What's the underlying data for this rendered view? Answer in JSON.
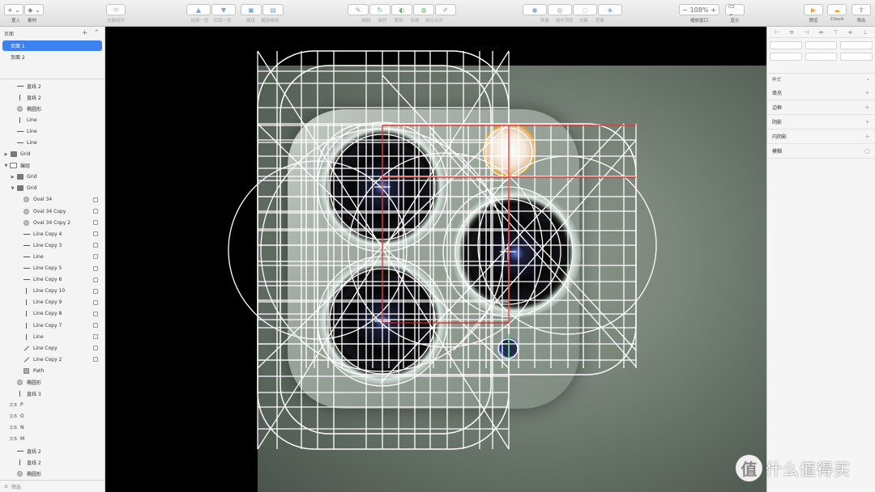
{
  "toolbar": {
    "insert_label": "置入",
    "material_label": "素材",
    "create_symbol_label": "创建组件",
    "front_back_labels": [
      "前面一层",
      "后面一层"
    ],
    "group_label": "编组",
    "ungroup_label": "解除编组",
    "path_tools_labels": [
      "编辑",
      "旋转",
      "蒙版",
      "拓展",
      "路径合并"
    ],
    "boolean_labels": [
      "联集",
      "减去顶层",
      "交集",
      "差集"
    ],
    "zoom_value": "108%",
    "zoom_minus": "−",
    "zoom_plus": "+",
    "zoom_label": "缩放窗口",
    "view_label": "显示",
    "preview_label": "预览",
    "cloud_label": "Cloud",
    "export_label": "导出",
    "accent_color": "#f5a623",
    "preview_icon": "play-icon",
    "cloud_icon": "cloud-icon",
    "export_icon": "share-icon"
  },
  "left_panel": {
    "pages_header": "页面",
    "add_icon": "plus-icon",
    "collapse_icon": "chevron-up-icon",
    "pages": [
      {
        "label": "页面 1",
        "selected": true
      },
      {
        "label": "页面 2",
        "selected": false
      }
    ],
    "layers": [
      {
        "name": "直线 2",
        "icon": "line",
        "indent": 1,
        "arrow": ""
      },
      {
        "name": "直线 2",
        "icon": "vline",
        "indent": 1,
        "arrow": ""
      },
      {
        "name": "椭圆形",
        "icon": "oval",
        "indent": 1,
        "arrow": ""
      },
      {
        "name": "Line",
        "icon": "vline",
        "indent": 1,
        "arrow": ""
      },
      {
        "name": "Line",
        "icon": "line",
        "indent": 1,
        "arrow": ""
      },
      {
        "name": "Line",
        "icon": "line",
        "indent": 1,
        "arrow": ""
      },
      {
        "name": "Grid",
        "icon": "group",
        "indent": 0,
        "arrow": "▶"
      },
      {
        "name": "编组",
        "icon": "folder",
        "indent": 0,
        "arrow": "▼"
      },
      {
        "name": "Grid",
        "icon": "group",
        "indent": 1,
        "arrow": "▶"
      },
      {
        "name": "Grid",
        "icon": "group",
        "indent": 1,
        "arrow": "▼"
      },
      {
        "name": "Oval 34",
        "icon": "oval",
        "indent": 2,
        "arrow": "",
        "mask": true
      },
      {
        "name": "Oval 34 Copy",
        "icon": "oval",
        "indent": 2,
        "arrow": "",
        "mask": true
      },
      {
        "name": "Oval 34 Copy 2",
        "icon": "oval",
        "indent": 2,
        "arrow": "",
        "mask": true
      },
      {
        "name": "Line Copy 4",
        "icon": "line",
        "indent": 2,
        "arrow": "",
        "mask": true
      },
      {
        "name": "Line Copy 3",
        "icon": "line",
        "indent": 2,
        "arrow": "",
        "mask": true
      },
      {
        "name": "Line",
        "icon": "line",
        "indent": 2,
        "arrow": "",
        "mask": true
      },
      {
        "name": "Line Copy 5",
        "icon": "line",
        "indent": 2,
        "arrow": "",
        "mask": true
      },
      {
        "name": "Line Copy 6",
        "icon": "line",
        "indent": 2,
        "arrow": "",
        "mask": true
      },
      {
        "name": "Line Copy 10",
        "icon": "vline",
        "indent": 2,
        "arrow": "",
        "mask": true
      },
      {
        "name": "Line Copy 9",
        "icon": "vline",
        "indent": 2,
        "arrow": "",
        "mask": true
      },
      {
        "name": "Line Copy 8",
        "icon": "vline",
        "indent": 2,
        "arrow": "",
        "mask": true
      },
      {
        "name": "Line Copy 7",
        "icon": "vline",
        "indent": 2,
        "arrow": "",
        "mask": true
      },
      {
        "name": "Line",
        "icon": "vline",
        "indent": 2,
        "arrow": "",
        "mask": true
      },
      {
        "name": "Line Copy",
        "icon": "diag",
        "indent": 2,
        "arrow": "",
        "mask": true
      },
      {
        "name": "Line Copy 2",
        "icon": "diag",
        "indent": 2,
        "arrow": "",
        "mask": true
      },
      {
        "name": "Path",
        "icon": "path",
        "indent": 2,
        "arrow": ""
      },
      {
        "name": "椭圆形",
        "icon": "oval",
        "indent": 1,
        "arrow": ""
      },
      {
        "name": "直线 3",
        "icon": "vline",
        "indent": 1,
        "arrow": ""
      },
      {
        "name": "P",
        "icon": "text",
        "indent": 0,
        "arrow": ""
      },
      {
        "name": "O",
        "icon": "text",
        "indent": 0,
        "arrow": ""
      },
      {
        "name": "N",
        "icon": "text",
        "indent": 0,
        "arrow": ""
      },
      {
        "name": "M",
        "icon": "text",
        "indent": 0,
        "arrow": ""
      },
      {
        "name": "直线 2",
        "icon": "line",
        "indent": 1,
        "arrow": ""
      },
      {
        "name": "直线 2",
        "icon": "vline",
        "indent": 1,
        "arrow": ""
      },
      {
        "name": "椭圆形",
        "icon": "oval",
        "indent": 1,
        "arrow": ""
      }
    ],
    "text_type_label": "文本",
    "filter_label": "筛选",
    "filter_icon": "filter-icon"
  },
  "right_panel": {
    "style_header": "样式",
    "sections": [
      "填充",
      "边框",
      "阴影",
      "内阴影",
      "模糊"
    ],
    "align_icons": [
      "align-left-icon",
      "align-center-icon",
      "align-right-icon",
      "distribute-icon",
      "align-top-icon",
      "align-middle-icon",
      "align-bottom-icon"
    ]
  },
  "canvas": {
    "background": "#000000",
    "grid_color": "#ffffff",
    "guide_color": "#e0201c",
    "flash_ring_color": "#e8a320",
    "mic_ring_color": "#5272c6"
  },
  "watermark": {
    "logo_glyph": "值",
    "text": "什么值得买"
  }
}
